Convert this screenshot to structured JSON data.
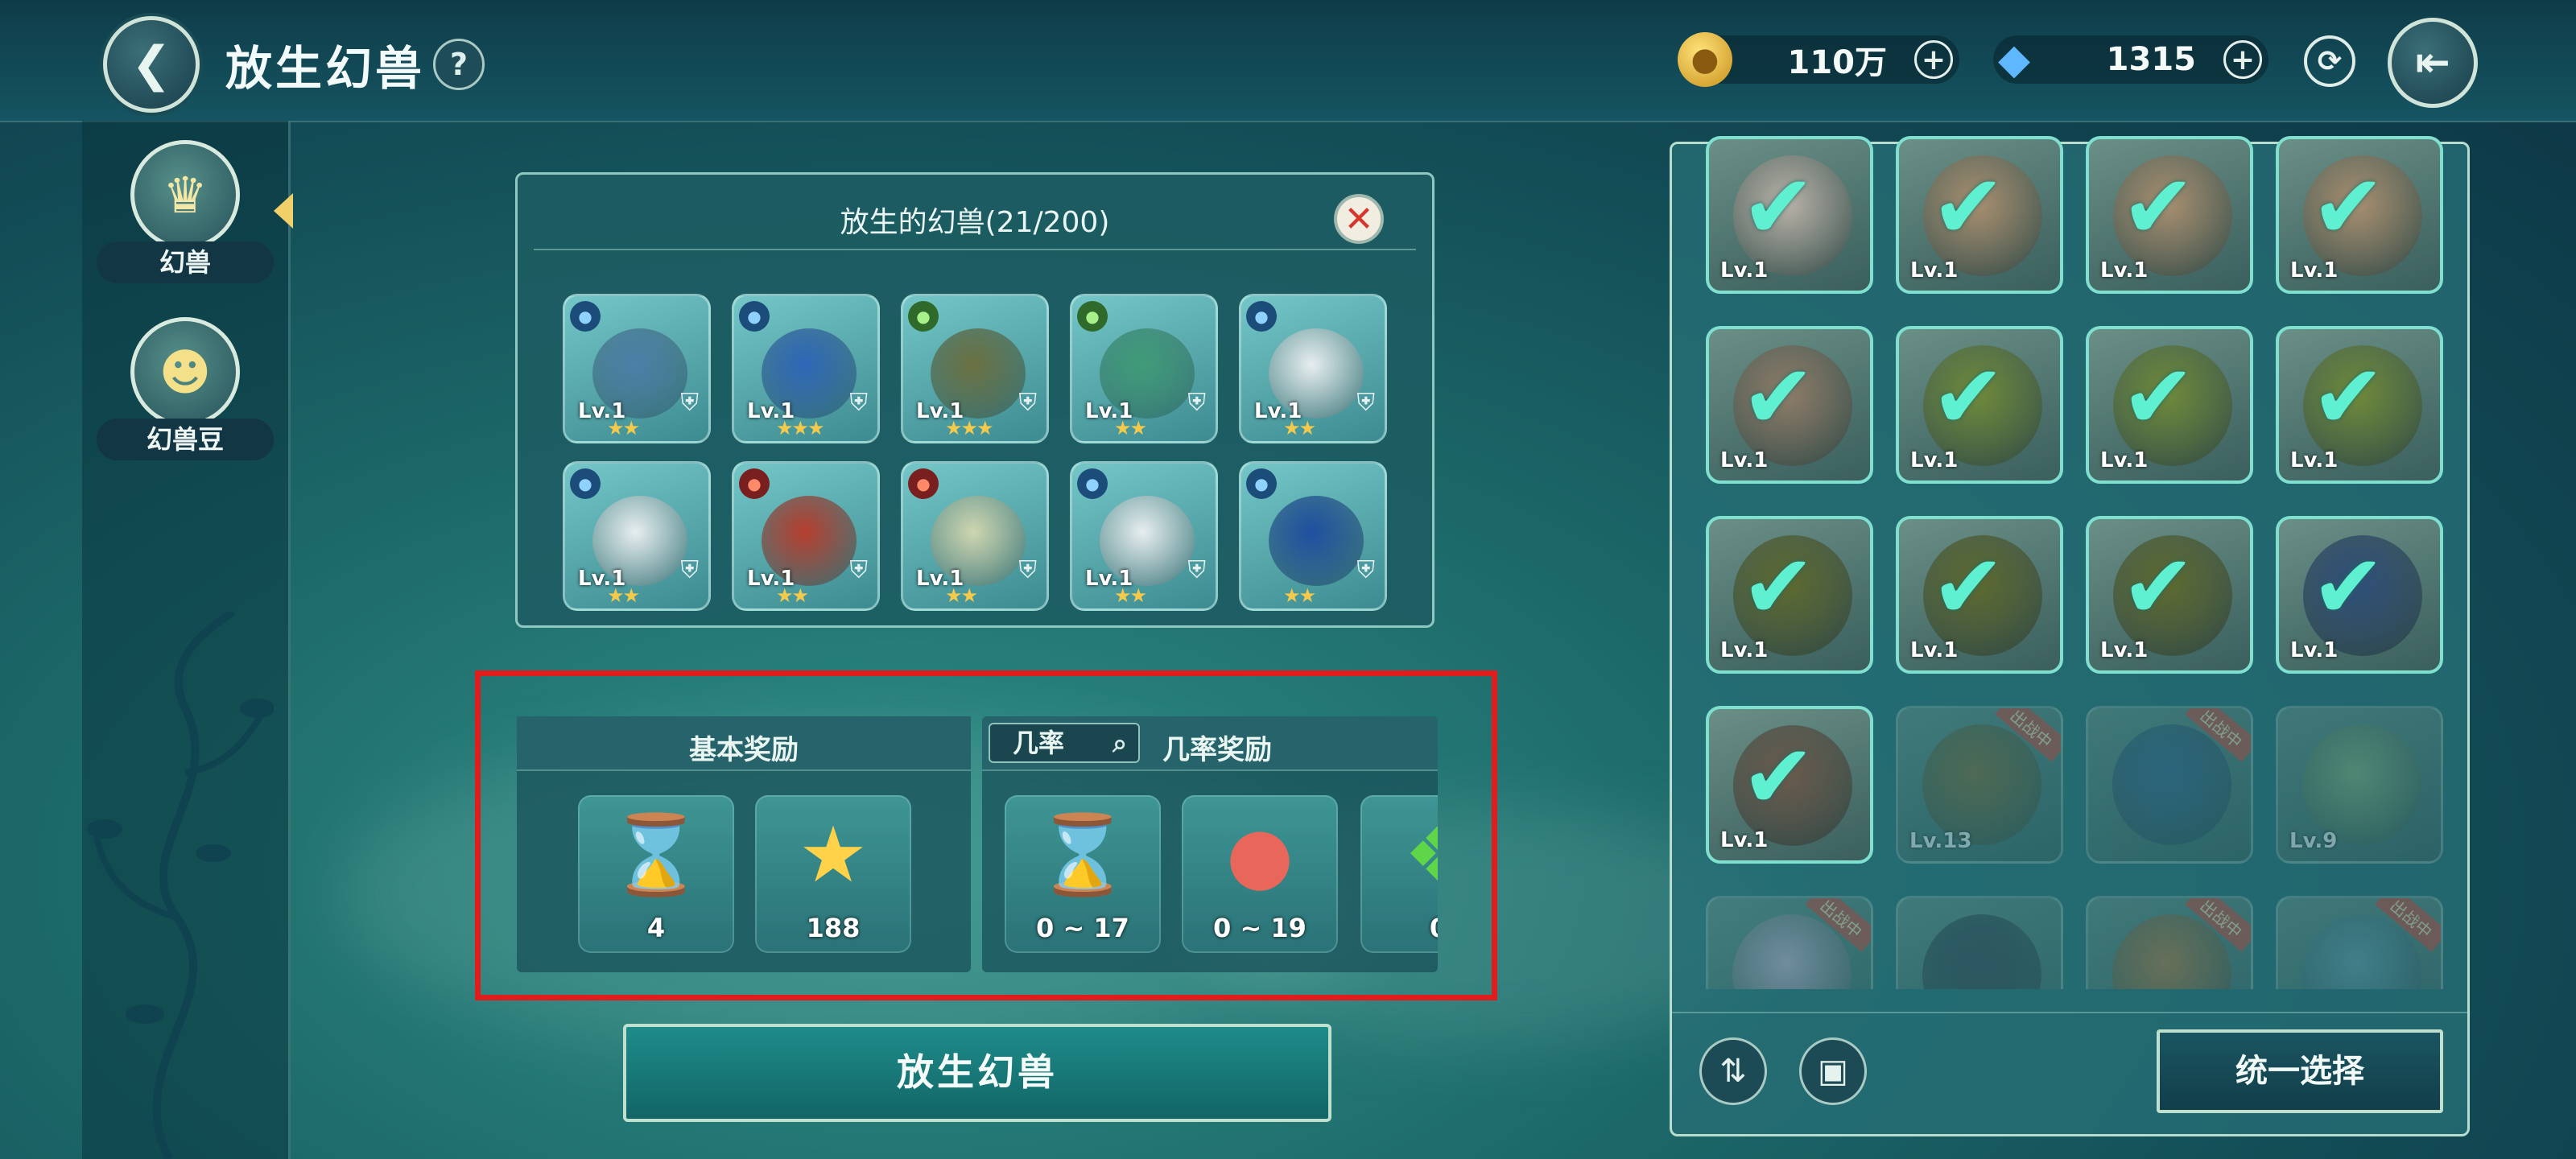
{
  "header": {
    "title": "放生幻兽",
    "help_label": "?",
    "gold": "110万",
    "diamond": "1315"
  },
  "sidebar": {
    "items": [
      {
        "label": "幻兽",
        "active": true
      },
      {
        "label": "幻兽豆",
        "active": false
      }
    ]
  },
  "released": {
    "title": "放生的幻兽(21/200)",
    "cards": [
      {
        "lv": "Lv.1",
        "stars": "★★",
        "elem": "water",
        "color": "#4d7fa8"
      },
      {
        "lv": "Lv.1",
        "stars": "★★★",
        "elem": "water",
        "color": "#2f66b8"
      },
      {
        "lv": "Lv.1",
        "stars": "★★★",
        "elem": "leaf",
        "color": "#6b7040"
      },
      {
        "lv": "Lv.1",
        "stars": "★★",
        "elem": "leaf",
        "color": "#3f9c78"
      },
      {
        "lv": "Lv.1",
        "stars": "★★",
        "elem": "water",
        "color": "#e8eef0"
      },
      {
        "lv": "Lv.1",
        "stars": "★★",
        "elem": "water",
        "color": "#e8eef0"
      },
      {
        "lv": "Lv.1",
        "stars": "★★",
        "elem": "fire",
        "color": "#b63e2e"
      },
      {
        "lv": "Lv.1",
        "stars": "★★",
        "elem": "fire",
        "color": "#cfd6b0"
      },
      {
        "lv": "Lv.1",
        "stars": "★★",
        "elem": "water",
        "color": "#e8eef0"
      },
      {
        "lv": "",
        "stars": "★★",
        "elem": "water",
        "color": "#1f4fa0"
      }
    ]
  },
  "rewards": {
    "basic_label": "基本奖励",
    "rate_button": "几率",
    "rate_label": "几率奖励",
    "basic": [
      {
        "icon": "hourglass",
        "count": "4"
      },
      {
        "icon": "star",
        "count": "188"
      }
    ],
    "chance": [
      {
        "icon": "hourglass",
        "count": "0 ~ 17"
      },
      {
        "icon": "egg",
        "count": "0 ~ 19"
      },
      {
        "icon": "green-gem",
        "count": "0"
      }
    ]
  },
  "release_button": "放生幻兽",
  "inventory": {
    "select_all": "统一选择",
    "cards": [
      {
        "lv": "Lv.1",
        "stars": "★★",
        "checked": true,
        "color": "#b9b2a8"
      },
      {
        "lv": "Lv.1",
        "stars": "★★",
        "checked": true,
        "color": "#a88f70"
      },
      {
        "lv": "Lv.1",
        "stars": "★★",
        "checked": true,
        "color": "#a88f70"
      },
      {
        "lv": "Lv.1",
        "stars": "★★",
        "checked": true,
        "color": "#a88f70"
      },
      {
        "lv": "Lv.1",
        "stars": "★★",
        "checked": true,
        "color": "#8f7c68"
      },
      {
        "lv": "Lv.1",
        "stars": "★★",
        "checked": true,
        "color": "#6f8a3a"
      },
      {
        "lv": "Lv.1",
        "stars": "★★",
        "checked": true,
        "color": "#6f8a3a"
      },
      {
        "lv": "Lv.1",
        "stars": "★★",
        "checked": true,
        "color": "#6f8a3a"
      },
      {
        "lv": "Lv.1",
        "stars": "★",
        "checked": true,
        "color": "#5e6a30"
      },
      {
        "lv": "Lv.1",
        "stars": "★★",
        "checked": true,
        "color": "#5e6a30"
      },
      {
        "lv": "Lv.1",
        "stars": "★★",
        "checked": true,
        "color": "#5e6a30"
      },
      {
        "lv": "Lv.1",
        "stars": "★",
        "checked": true,
        "color": "#2f4f7a"
      },
      {
        "lv": "Lv.1",
        "stars": "★",
        "checked": true,
        "color": "#6a5a4c"
      },
      {
        "lv": "Lv.13",
        "stars": "★★★★",
        "checked": false,
        "color": "#8a6a2e",
        "tag": "出战中"
      },
      {
        "lv": "",
        "stars": "★★★★",
        "checked": false,
        "color": "#3a5f8f",
        "tag": "出战中"
      },
      {
        "lv": "Lv.9",
        "stars": "★★★★★",
        "checked": false,
        "color": "#8fb27a"
      },
      {
        "lv": "",
        "stars": "",
        "checked": false,
        "color": "#d9b9d6",
        "tag": "出战中"
      },
      {
        "lv": "",
        "stars": "",
        "checked": false,
        "color": "#3a3a4a"
      },
      {
        "lv": "",
        "stars": "",
        "checked": false,
        "color": "#c77a3a",
        "tag": "出战中"
      },
      {
        "lv": "",
        "stars": "",
        "checked": false,
        "color": "#6aa0b0",
        "tag": "出战中"
      }
    ]
  }
}
